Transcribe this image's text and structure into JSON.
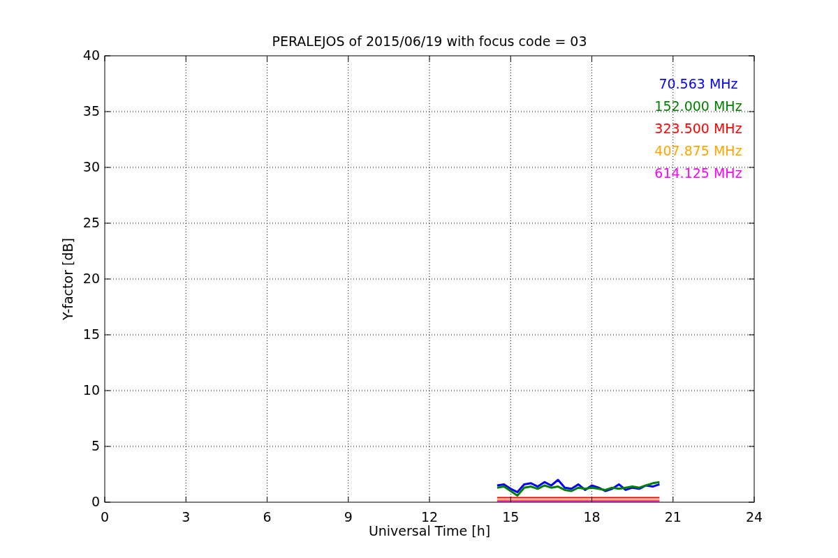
{
  "chart_data": {
    "type": "line",
    "title": "PERALEJOS of 2015/06/19 with focus code = 03",
    "xlabel": "Universal Time [h]",
    "ylabel": "Y-factor [dB]",
    "x": [
      14.5,
      14.75,
      15,
      15.25,
      15.5,
      15.75,
      16,
      16.25,
      16.5,
      16.75,
      17,
      17.25,
      17.5,
      17.75,
      18,
      18.25,
      18.5,
      18.75,
      19,
      19.25,
      19.5,
      19.75,
      20,
      20.25,
      20.5
    ],
    "series": [
      {
        "name": "70.563 MHz",
        "color": "#0000ff",
        "values": [
          1.5,
          1.6,
          1.2,
          0.9,
          1.6,
          1.7,
          1.4,
          1.8,
          1.5,
          2.0,
          1.3,
          1.2,
          1.6,
          1.1,
          1.5,
          1.3,
          1.0,
          1.2,
          1.6,
          1.1,
          1.3,
          1.2,
          1.5,
          1.4,
          1.6
        ]
      },
      {
        "name": "152.000 MHz",
        "color": "#008000",
        "values": [
          1.3,
          1.4,
          1.0,
          0.6,
          1.3,
          1.4,
          1.2,
          1.5,
          1.3,
          1.4,
          1.1,
          1.0,
          1.3,
          1.2,
          1.3,
          1.2,
          1.1,
          1.3,
          1.2,
          1.3,
          1.4,
          1.3,
          1.5,
          1.7,
          1.8
        ]
      },
      {
        "name": "323.500 MHz",
        "color": "#ff0000",
        "values": [
          0.4,
          0.4,
          0.4,
          0.4,
          0.4,
          0.4,
          0.4,
          0.4,
          0.4,
          0.4,
          0.4,
          0.4,
          0.4,
          0.4,
          0.4,
          0.4,
          0.4,
          0.4,
          0.4,
          0.4,
          0.4,
          0.4,
          0.4,
          0.4,
          0.4
        ]
      },
      {
        "name": "407.875 MHz",
        "color": "#ffa500",
        "values": [
          0.2,
          0.2,
          0.2,
          0.2,
          0.2,
          0.2,
          0.2,
          0.2,
          0.2,
          0.2,
          0.2,
          0.2,
          0.2,
          0.2,
          0.2,
          0.2,
          0.2,
          0.2,
          0.2,
          0.2,
          0.2,
          0.2,
          0.2,
          0.2,
          0.2
        ]
      },
      {
        "name": "614.125 MHz",
        "color": "#ff00ff",
        "values": [
          0.1,
          0.1,
          0.1,
          0.1,
          0.1,
          0.1,
          0.1,
          0.1,
          0.1,
          0.1,
          0.1,
          0.1,
          0.1,
          0.1,
          0.1,
          0.1,
          0.1,
          0.1,
          0.1,
          0.1,
          0.1,
          0.1,
          0.1,
          0.1,
          0.1
        ]
      }
    ],
    "grid": true,
    "xlim": [
      0,
      24
    ],
    "ylim": [
      0,
      40
    ],
    "xticks": [
      0,
      3,
      6,
      9,
      12,
      15,
      18,
      21,
      24
    ],
    "yticks": [
      0,
      5,
      10,
      15,
      20,
      25,
      30,
      35,
      40
    ]
  }
}
